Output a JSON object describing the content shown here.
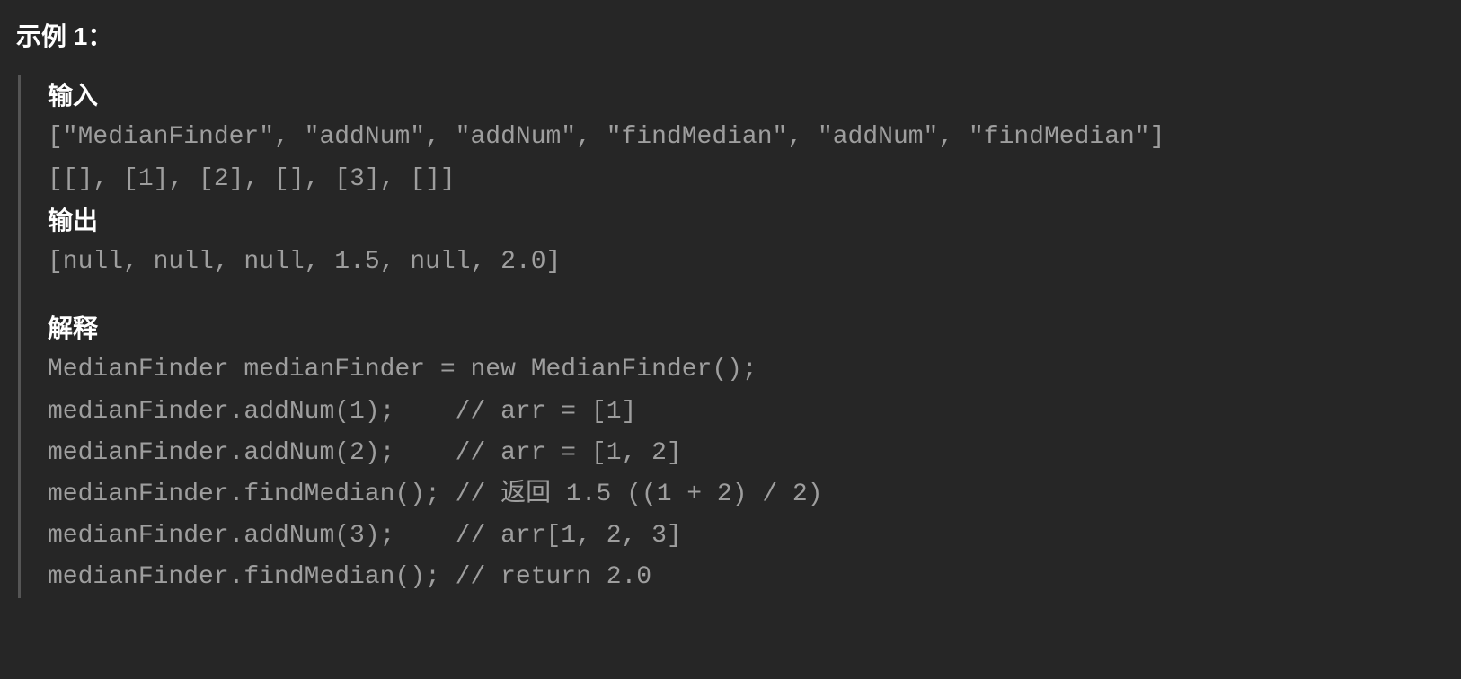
{
  "heading": "示例 1：",
  "labels": {
    "input": "输入",
    "output": "输出",
    "explain": "解释"
  },
  "input": {
    "ops": "[\"MedianFinder\", \"addNum\", \"addNum\", \"findMedian\", \"addNum\", \"findMedian\"]",
    "args": "[[], [1], [2], [], [3], []]"
  },
  "output": "[null, null, null, 1.5, null, 2.0]",
  "explain": {
    "l1": "MedianFinder medianFinder = new MedianFinder();",
    "l2": "medianFinder.addNum(1);    // arr = [1]",
    "l3": "medianFinder.addNum(2);    // arr = [1, 2]",
    "l4": "medianFinder.findMedian(); // 返回 1.5 ((1 + 2) / 2)",
    "l5": "medianFinder.addNum(3);    // arr[1, 2, 3]",
    "l6": "medianFinder.findMedian(); // return 2.0"
  }
}
